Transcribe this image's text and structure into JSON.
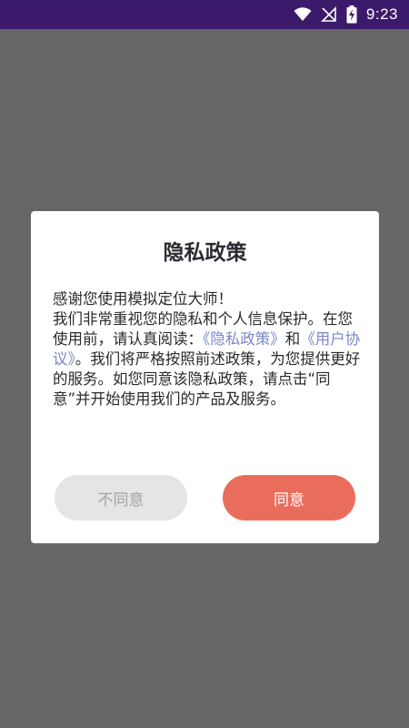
{
  "status_bar": {
    "time": "9:23",
    "icons": [
      "wifi-icon",
      "signal-muted-icon",
      "battery-charging-icon"
    ]
  },
  "dialog": {
    "title": "隐私政策",
    "body": {
      "line1": "感谢您使用模拟定位大师！",
      "text1": "我们非常重视您的隐私和个人信息保护。在您使用前，请认真阅读：",
      "privacy_link": "《隐私政策》",
      "conj": "和",
      "user_link": "《用户协议》",
      "text2": "。我们将严格按照前述政策，为您提供更好的服务。如您同意该隐私政策，请点击“同意”并开始使用我们的产品及服务。"
    },
    "disagree_label": "不同意",
    "agree_label": "同意"
  },
  "colors": {
    "status_bar": "#3c1a6b",
    "overlay": "#666666",
    "link": "#7b85c9",
    "agree": "#ea6d5c",
    "disagree": "#e5e5e5"
  }
}
